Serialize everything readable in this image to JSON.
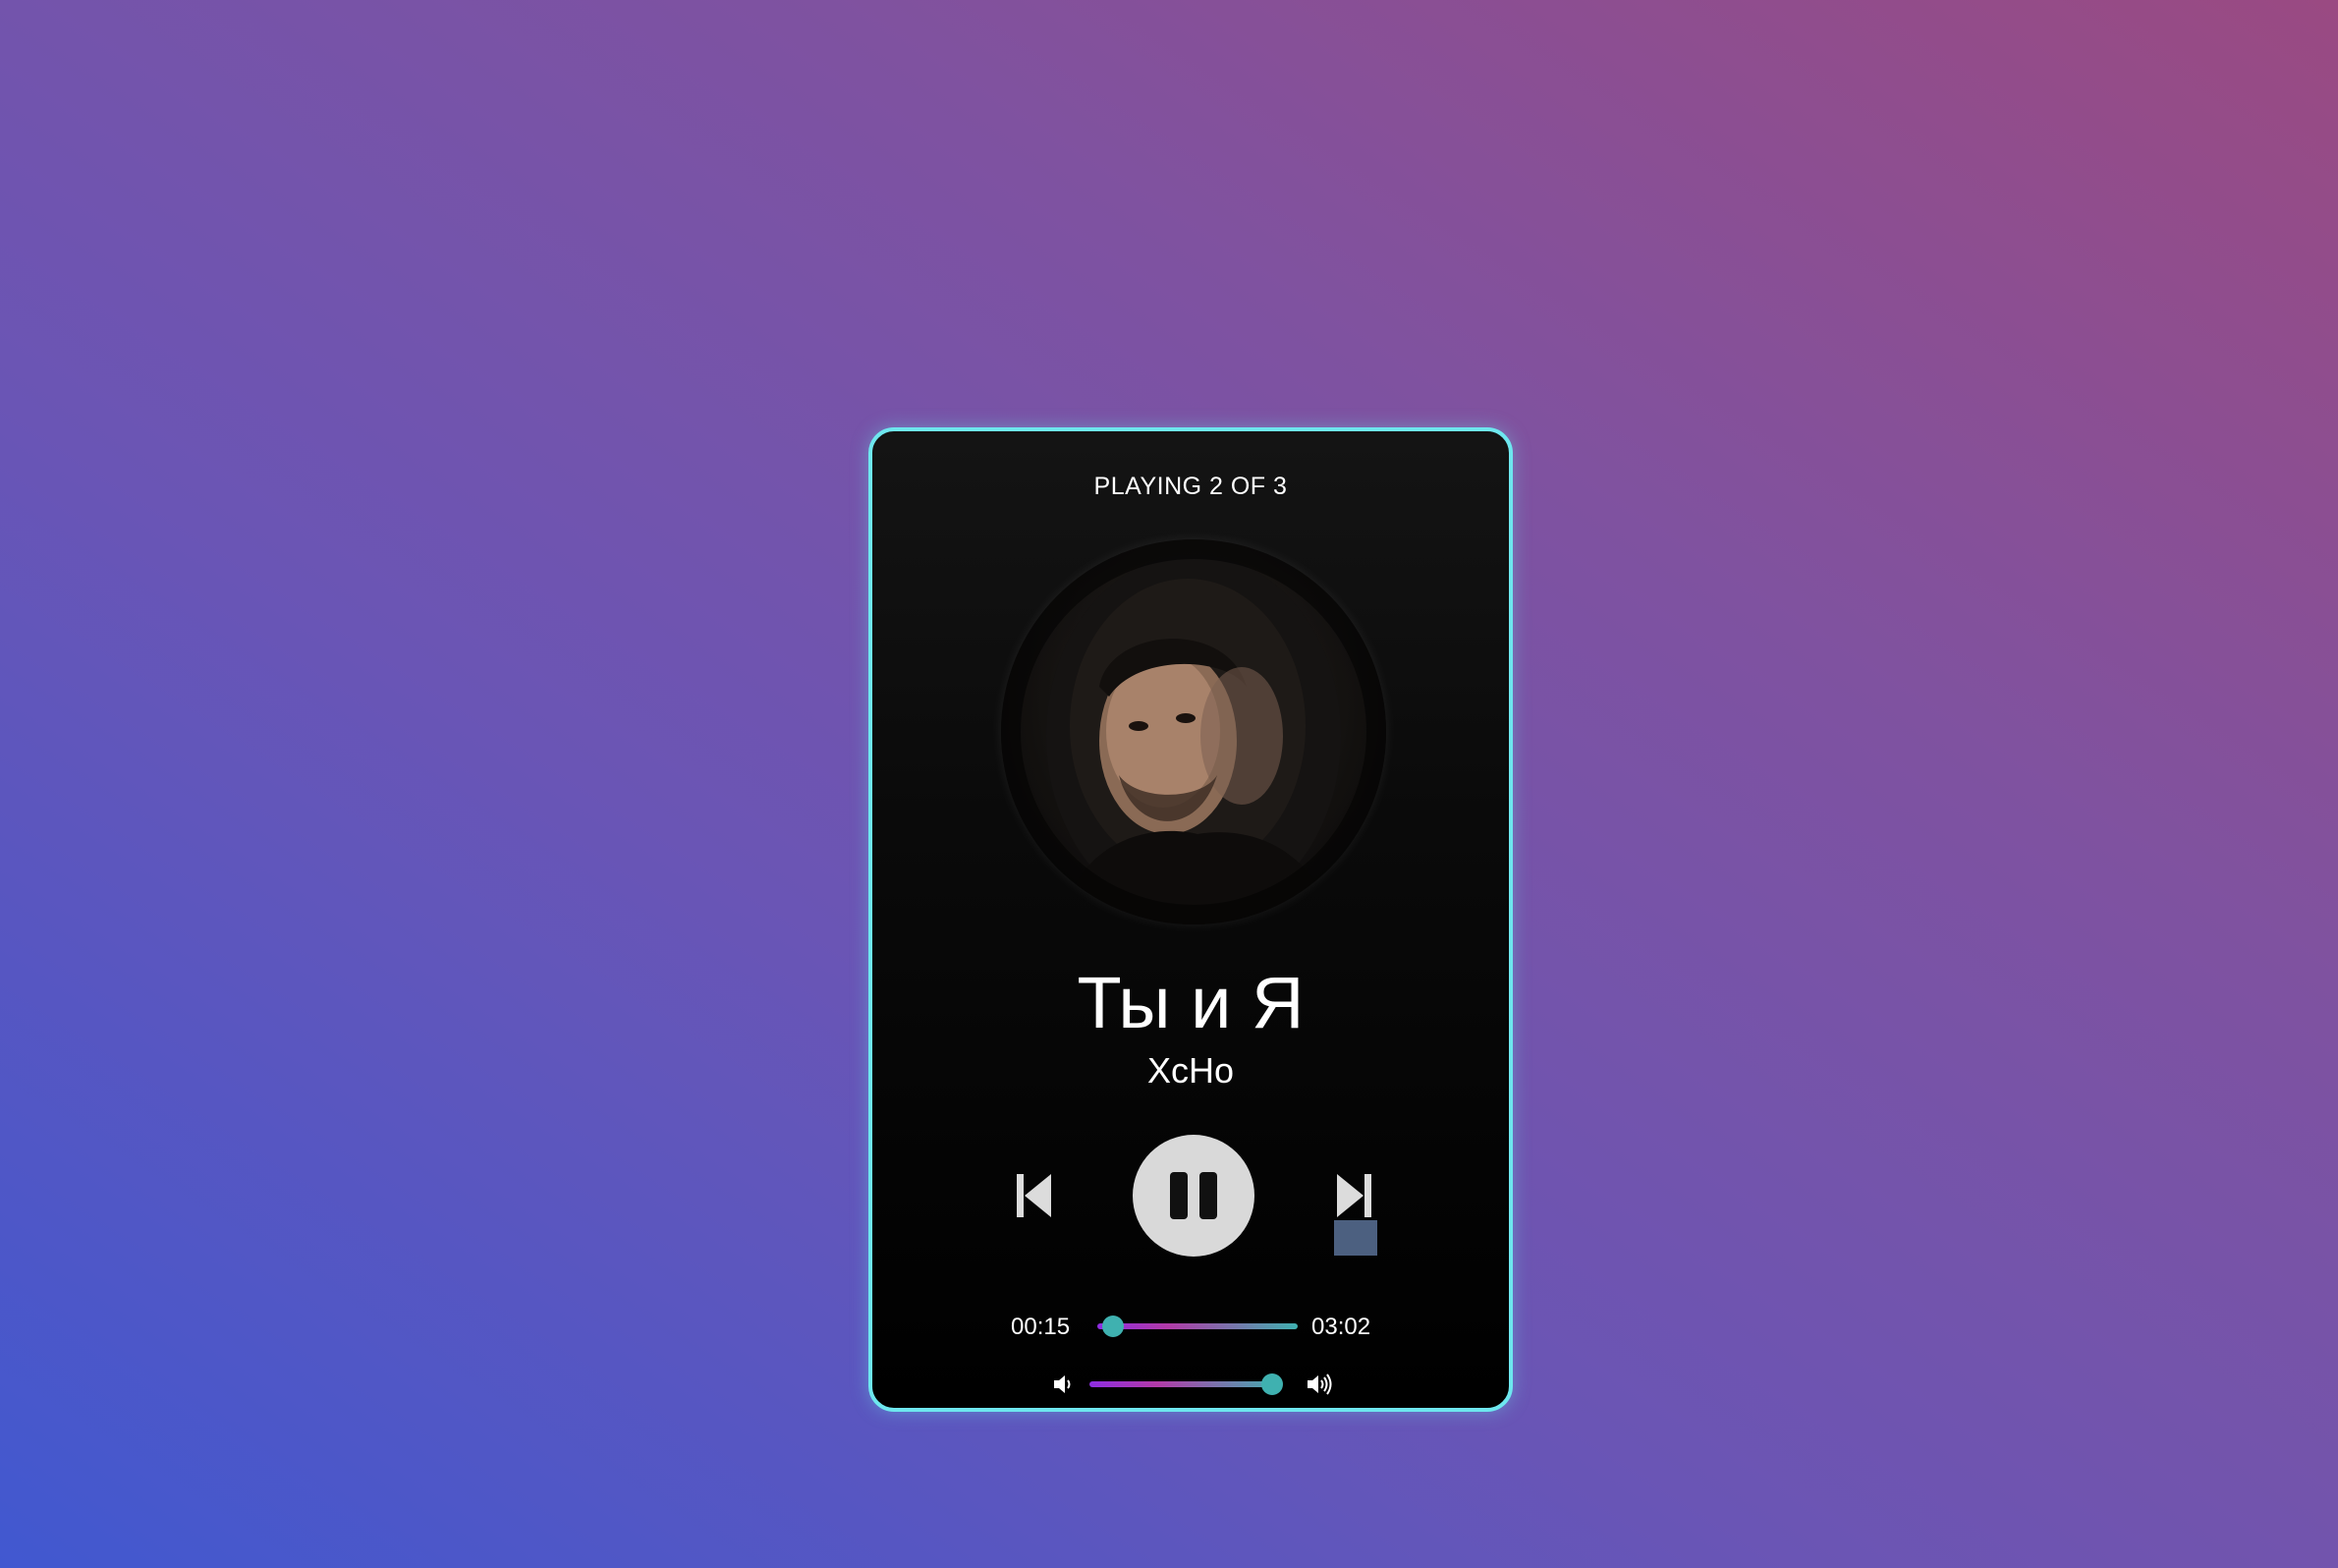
{
  "player": {
    "counter": "PLAYING 2 OF 3",
    "track_title": "Ты и Я",
    "artist": "XcHo",
    "time_current": "00:15",
    "time_total": "03:02",
    "progress_fraction": 0.08,
    "volume_fraction": 0.95,
    "controls": {
      "prev_icon": "skip-back-icon",
      "play_pause_icon": "pause-icon",
      "next_icon": "skip-forward-icon",
      "volume_low_icon": "volume-low-icon",
      "volume_high_icon": "volume-high-icon"
    }
  },
  "colors": {
    "border_accent": "#6ee7ef",
    "slider_thumb": "#3fb1b0",
    "slider_gradient_start": "#8e2de2",
    "button_fill": "#d9d9d9"
  }
}
